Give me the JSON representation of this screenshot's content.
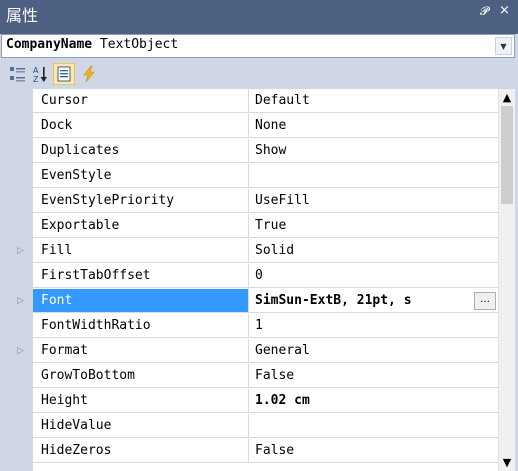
{
  "window": {
    "title": "属性",
    "pin_glyph": "ᵖ",
    "close_glyph": "×"
  },
  "object_selector": {
    "name": "CompanyName",
    "type": "TextObject",
    "dropdown_glyph": "▼"
  },
  "toolbar": {
    "buttons": [
      "categorized-view",
      "alphabetical-view",
      "properties",
      "events"
    ],
    "active": "properties"
  },
  "properties": [
    {
      "name": "Cursor",
      "value": "Default",
      "expandable": false
    },
    {
      "name": "Dock",
      "value": "None",
      "expandable": false
    },
    {
      "name": "Duplicates",
      "value": "Show",
      "expandable": false
    },
    {
      "name": "EvenStyle",
      "value": "",
      "expandable": false
    },
    {
      "name": "EvenStylePriority",
      "value": "UseFill",
      "expandable": false
    },
    {
      "name": "Exportable",
      "value": "True",
      "expandable": false
    },
    {
      "name": "Fill",
      "value": "Solid",
      "expandable": true
    },
    {
      "name": "FirstTabOffset",
      "value": "0",
      "expandable": false
    },
    {
      "name": "Font",
      "value": "SimSun-ExtB, 21pt, s",
      "expandable": true,
      "selected": true,
      "bold": true,
      "has_ellipsis": true
    },
    {
      "name": "FontWidthRatio",
      "value": "1",
      "expandable": false
    },
    {
      "name": "Format",
      "value": "General",
      "expandable": true
    },
    {
      "name": "GrowToBottom",
      "value": "False",
      "expandable": false
    },
    {
      "name": "Height",
      "value": "1.02 cm",
      "expandable": false,
      "bold": true
    },
    {
      "name": "HideValue",
      "value": "",
      "expandable": false
    },
    {
      "name": "HideZeros",
      "value": "False",
      "expandable": false
    }
  ],
  "ellipsis_label": "…",
  "expander_glyph": "▷",
  "scrollbar": {
    "up_glyph": "▲",
    "down_glyph": "▼",
    "position": 0.0
  }
}
